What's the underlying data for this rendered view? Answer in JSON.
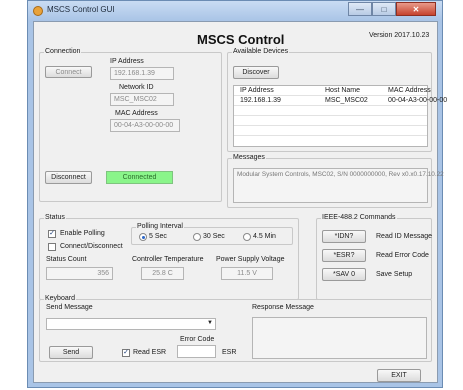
{
  "window": {
    "title": "MSCS Control GUI",
    "main_title": "MSCS Control",
    "version": "Version 2017.10.23"
  },
  "connection": {
    "label": "Connection",
    "connect_label": "Connect",
    "ip_label": "IP Address",
    "ip_value": "192.168.1.39",
    "network_id_label": "Network ID",
    "network_id_value": "MSC_MSC02",
    "mac_label": "MAC Address",
    "mac_value": "00-04-A3-00-00-00",
    "disconnect_label": "Disconnect",
    "status_text": "Connected",
    "status_color": "#8af58a"
  },
  "devices": {
    "label": "Available Devices",
    "discover_label": "Discover",
    "columns": [
      "IP Address",
      "Host Name",
      "MAC Address"
    ],
    "rows": [
      [
        "192.168.1.39",
        "MSC_MSC02",
        "00-04-A3-00-00-00"
      ]
    ]
  },
  "messages": {
    "label": "Messages",
    "text": "Modular System Controls, MSC02, S/N 0000000000, Rev x0.x0.17.10.22"
  },
  "status": {
    "label": "Status",
    "enable_polling_label": "Enable Polling",
    "enable_polling_checked": true,
    "connect_disconnect_label": "Connect/Disconnect",
    "connect_disconnect_checked": false,
    "polling_interval_label": "Polling Interval",
    "intervals": [
      "5 Sec",
      "30 Sec",
      "4.5 Min"
    ],
    "selected_interval": "5 Sec",
    "status_count_label": "Status Count",
    "status_count_value": "356",
    "controller_temp_label": "Controller Temperature",
    "controller_temp_value": "25.8 C",
    "psu_voltage_label": "Power Supply Voltage",
    "psu_voltage_value": "11.5 V"
  },
  "ieee": {
    "label": "IEEE-488.2 Commands",
    "commands": [
      {
        "button": "*IDN?",
        "description": "Read ID Message"
      },
      {
        "button": "*ESR?",
        "description": "Read Error Code"
      },
      {
        "button": "*SAV 0",
        "description": "Save Setup"
      }
    ]
  },
  "keyboard": {
    "label": "Keyboard",
    "send_message_label": "Send Message",
    "send_message_value": "",
    "response_label": "Response Message",
    "send_label": "Send",
    "read_esr_label": "Read ESR",
    "read_esr_checked": true,
    "error_code_label": "Error Code",
    "esr_label": "ESR",
    "error_code_value": ""
  },
  "exit_label": "EXIT",
  "icons": [
    "app-icon",
    "minimize-icon",
    "maximize-icon",
    "close-icon",
    "dropdown-arrow-icon",
    "checkmark-icon"
  ]
}
